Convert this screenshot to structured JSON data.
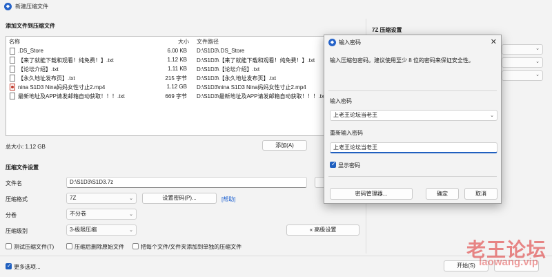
{
  "window": {
    "title": "新建压缩文件",
    "close_glyph": "✕"
  },
  "add_section": {
    "title": "添加文件到压缩文件"
  },
  "file_table": {
    "headers": {
      "name": "名称",
      "size": "大小",
      "path": "文件路径"
    },
    "rows": [
      {
        "name": ".DS_Store",
        "size": "6.00 KB",
        "path": "D:\\S1D3\\.DS_Store",
        "icon": "file-icon"
      },
      {
        "name": "【来了就能下载和观看！纯免费！】.txt",
        "size": "1.12 KB",
        "path": "D:\\S1D3\\【来了就能下载和观看！纯免费！】.txt",
        "icon": "text-file-icon"
      },
      {
        "name": "【论坛介绍】.txt",
        "size": "1.11 KB",
        "path": "D:\\S1D3\\【论坛介绍】.txt",
        "icon": "text-file-icon"
      },
      {
        "name": "【永久地址发布页】.txt",
        "size": "215 字节",
        "path": "D:\\S1D3\\【永久地址发布页】.txt",
        "icon": "text-file-icon"
      },
      {
        "name": "nina S1D3 Nina妈妈女性寸止2.mp4",
        "size": "1.12 GB",
        "path": "D:\\S1D3\\nina S1D3 Nina妈妈女性寸止2.mp4",
        "icon": "video-file-icon"
      },
      {
        "name": "最新地址及APP请发邮箱自动获取！！！.txt",
        "size": "669 字节",
        "path": "D:\\S1D3\\最新地址及APP请发邮箱自动获取！！！.txt",
        "icon": "text-file-icon"
      }
    ]
  },
  "total_size": "总大小: 1.12 GB",
  "add_button": "添加(A)",
  "settings": {
    "title": "压缩文件设置",
    "filename_label": "文件名",
    "filename_value": "D:\\S1D3\\S1D3.7z",
    "format_label": "压缩格式",
    "format_value": "7Z",
    "set_password_button": "设置密码(P)...",
    "help_link": "[帮助]",
    "split_label": "分卷",
    "split_value": "不分卷",
    "level_label": "压缩级别",
    "level_value": "3-极限压缩",
    "advanced_button": "« 高级设置",
    "opt_test": "测试压缩文件(T)",
    "opt_delete": "压缩后删除原始文件",
    "opt_separate": "把每个文件/文件夹添加到单独的压缩文件",
    "more_options": "更多选项..."
  },
  "right_panel": {
    "title": "7Z 压缩设置"
  },
  "start_button": "开始(S)",
  "password_dialog": {
    "title": "输入密码",
    "description": "输入压缩包密码。建议使用至少 8 位的密码来保证安全性。",
    "password_label": "输入密码",
    "password_value": "上老王论坛当老王",
    "reenter_label": "重新输入密码",
    "reenter_value": "上老王论坛当老王",
    "show_password": "显示密码",
    "manager_button": "密码管理器...",
    "ok_button": "确定",
    "cancel_button": "取消",
    "close_glyph": "✕"
  },
  "watermark": {
    "text": "老王论坛",
    "url": "laowang.vip"
  }
}
